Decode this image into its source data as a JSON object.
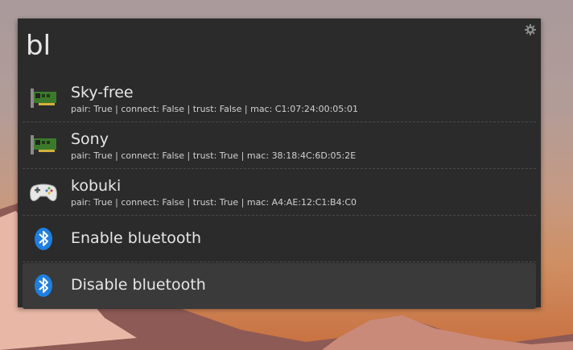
{
  "launcher": {
    "query": "bl",
    "settings_icon": "gear-icon",
    "results": [
      {
        "title": "Sky-free",
        "subtitle": "pair: True | connect: False | trust: False | mac: C1:07:24:00:05:01",
        "icon": "network-card-icon"
      },
      {
        "title": "Sony",
        "subtitle": "pair: True | connect: False | trust: True | mac: 38:18:4C:6D:05:2E",
        "icon": "network-card-icon"
      },
      {
        "title": "kobuki",
        "subtitle": "pair: True | connect: False | trust: True | mac: A4:AE:12:C1:B4:C0",
        "icon": "gamepad-icon"
      },
      {
        "title": "Enable bluetooth",
        "subtitle": "",
        "icon": "bluetooth-icon"
      },
      {
        "title": "Disable bluetooth",
        "subtitle": "",
        "icon": "bluetooth-icon"
      }
    ],
    "selected_index": 4
  }
}
